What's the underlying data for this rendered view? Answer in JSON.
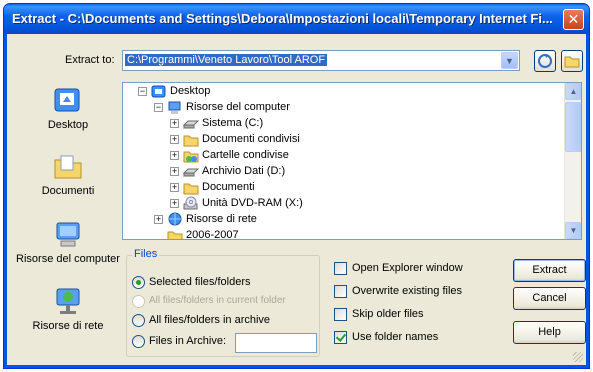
{
  "window": {
    "title": "Extract - C:\\Documents and Settings\\Debora\\Impostazioni locali\\Temporary Internet Fi...",
    "close_glyph": "✕"
  },
  "extract_to": {
    "label": "Extract to:",
    "path": "C:\\Programmi\\Veneto Lavoro\\Tool AROF"
  },
  "places": [
    {
      "label": "Desktop",
      "icon": "desktop-icon"
    },
    {
      "label": "Documenti",
      "icon": "documents-folder-icon"
    },
    {
      "label": "Risorse del computer",
      "icon": "my-computer-icon"
    },
    {
      "label": "Risorse di rete",
      "icon": "network-icon"
    }
  ],
  "tree": {
    "root": "Desktop",
    "computer": "Risorse del computer",
    "items": [
      {
        "label": "Sistema (C:)",
        "icon": "hard-drive-icon"
      },
      {
        "label": "Documenti condivisi",
        "icon": "folder-icon"
      },
      {
        "label": "Cartelle condivise",
        "icon": "shared-folder-icon"
      },
      {
        "label": "Archivio Dati (D:)",
        "icon": "hard-drive-icon"
      },
      {
        "label": "Documenti",
        "icon": "folder-icon"
      },
      {
        "label": "Unità DVD-RAM (X:)",
        "icon": "dvd-drive-icon"
      }
    ],
    "network": "Risorse di rete",
    "folder_2006": "2006-2007"
  },
  "files_group": {
    "legend": "Files",
    "options": [
      {
        "label": "Selected files/folders",
        "selected": true,
        "disabled": false
      },
      {
        "label": "All files/folders in current folder",
        "selected": false,
        "disabled": true
      },
      {
        "label": "All files/folders in archive",
        "selected": false,
        "disabled": false
      },
      {
        "label": "Files in Archive:",
        "selected": false,
        "disabled": false
      }
    ],
    "archive_value": ""
  },
  "options": [
    {
      "label": "Open Explorer window",
      "checked": false
    },
    {
      "label": "Overwrite existing files",
      "checked": false
    },
    {
      "label": "Skip older files",
      "checked": false
    },
    {
      "label": "Use folder names",
      "checked": true
    }
  ],
  "buttons": {
    "extract": "Extract",
    "cancel": "Cancel",
    "help": "Help"
  },
  "colors": {
    "titlebar": "#0054e3",
    "selection": "#316ac5",
    "checkmark": "#21a121"
  }
}
